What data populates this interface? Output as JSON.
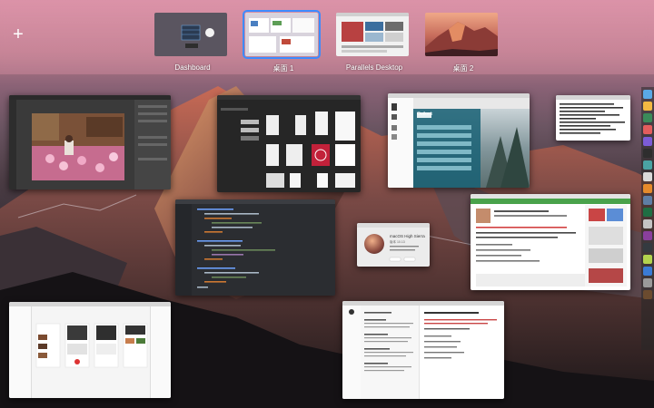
{
  "spaces": [
    {
      "label": "Dashboard",
      "active": false
    },
    {
      "label": "桌面 1",
      "active": true
    },
    {
      "label": "Parallels Desktop",
      "active": false
    },
    {
      "label": "桌面 2",
      "active": false
    }
  ],
  "add_space_label": "+",
  "windows": {
    "about_mac": {
      "title": "macOS High Sierra",
      "version": "版本 10.13"
    },
    "parallels_sidebar_title": "Outlook"
  },
  "colors": {
    "accent": "#3d8bff"
  },
  "icons": [
    "plus-icon"
  ]
}
